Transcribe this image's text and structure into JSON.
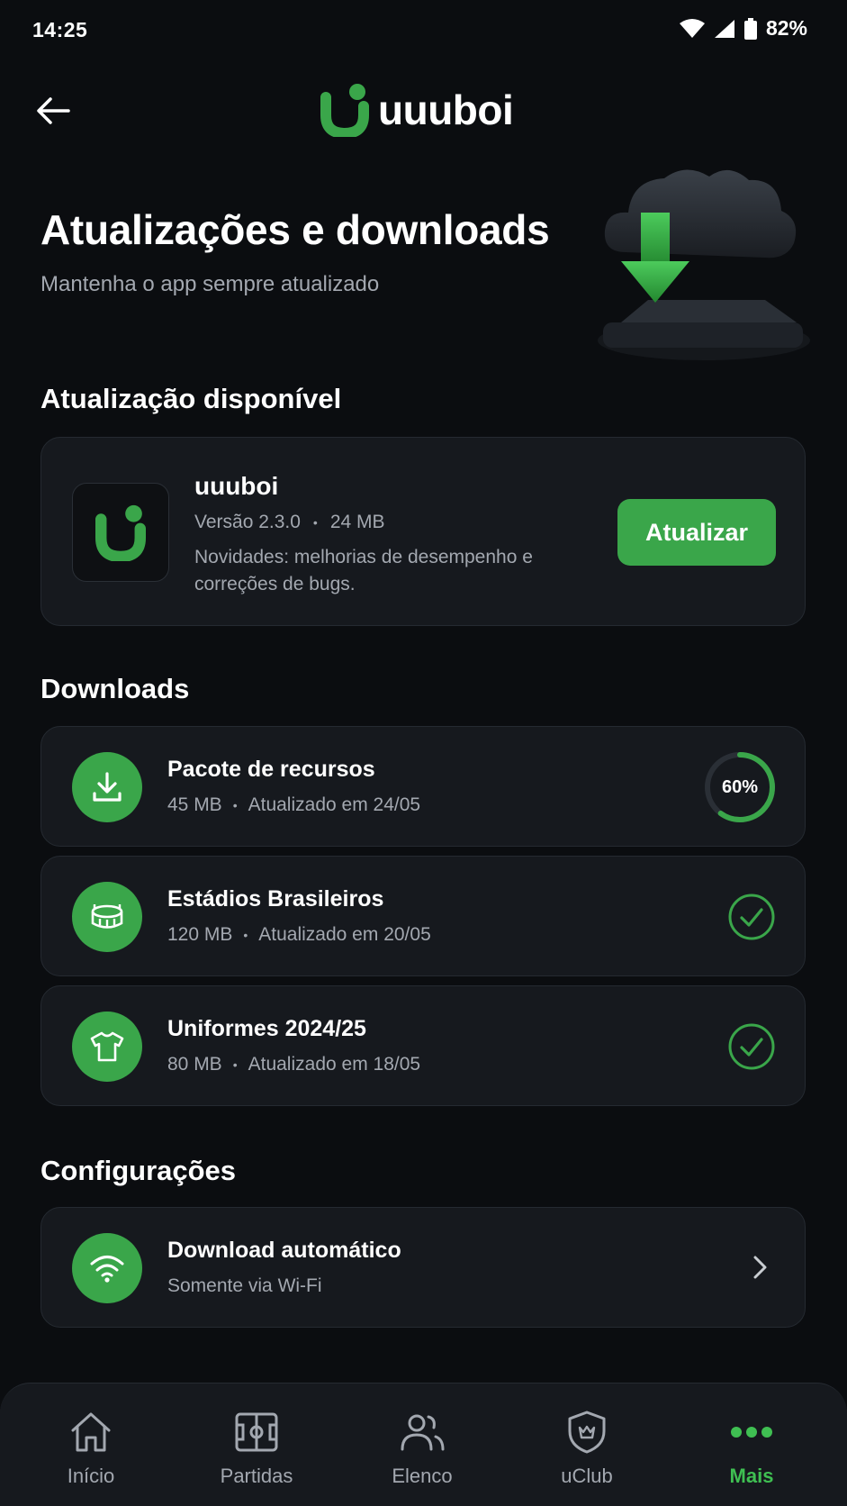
{
  "status_bar": {
    "time": "14:25",
    "battery": "82%"
  },
  "header": {
    "brand": "uuuboi"
  },
  "hero": {
    "title": "Atualizações e downloads",
    "subtitle": "Mantenha o app sempre atualizado"
  },
  "update_section": {
    "title": "Atualização disponível",
    "app_name": "uuuboi",
    "version": "Versão 2.3.0",
    "size": "24 MB",
    "notes": "Novidades: melhorias de desempenho e correções de bugs.",
    "button_label": "Atualizar"
  },
  "downloads_section": {
    "title": "Downloads",
    "items": [
      {
        "name": "Pacote de recursos",
        "size": "45 MB",
        "updated": "Atualizado em 24/05",
        "icon": "download-icon",
        "status": "progress",
        "progress": 0.6,
        "progress_label": "60%"
      },
      {
        "name": "Estádios Brasileiros",
        "size": "120 MB",
        "updated": "Atualizado em 20/05",
        "icon": "stadium-icon",
        "status": "done"
      },
      {
        "name": "Uniformes 2024/25",
        "size": "80 MB",
        "updated": "Atualizado em 18/05",
        "icon": "shirt-icon",
        "status": "done"
      }
    ]
  },
  "settings_section": {
    "title": "Configurações",
    "auto_download": {
      "label": "Download automático",
      "value": "Somente via Wi-Fi",
      "icon": "wifi-icon"
    }
  },
  "bottom_nav": {
    "items": [
      {
        "label": "Início",
        "icon": "home-icon",
        "active": false
      },
      {
        "label": "Partidas",
        "icon": "field-icon",
        "active": false
      },
      {
        "label": "Elenco",
        "icon": "users-icon",
        "active": false
      },
      {
        "label": "uClub",
        "icon": "shield-icon",
        "active": false
      },
      {
        "label": "Mais",
        "icon": "more-icon",
        "active": true
      }
    ]
  },
  "colors": {
    "accent": "#3aa64a",
    "background": "#0b0d10",
    "card": "#16191e",
    "muted_text": "#a3a8b0"
  }
}
